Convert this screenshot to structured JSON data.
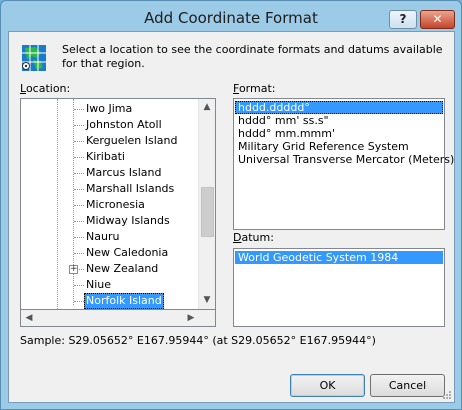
{
  "window": {
    "title": "Add Coordinate Format",
    "help_label": "?",
    "close_label": "✕"
  },
  "intro_text": "Select a location to see the coordinate formats and datums available for that region.",
  "location": {
    "label_accel": "L",
    "label_rest": "ocation:",
    "items": [
      {
        "label": "Iwo Jima"
      },
      {
        "label": "Johnston Atoll"
      },
      {
        "label": "Kerguelen Island"
      },
      {
        "label": "Kiribati"
      },
      {
        "label": "Marcus Island"
      },
      {
        "label": "Marshall Islands"
      },
      {
        "label": "Micronesia"
      },
      {
        "label": "Midway Islands"
      },
      {
        "label": "Nauru"
      },
      {
        "label": "New Caledonia"
      },
      {
        "label": "New Zealand",
        "expander": "+"
      },
      {
        "label": "Niue"
      },
      {
        "label": "Norfolk Island",
        "selected": true
      }
    ]
  },
  "format": {
    "label_accel": "F",
    "label_rest": "ormat:",
    "options": [
      {
        "label": "hddd.ddddd°",
        "selected": true
      },
      {
        "label": "hddd° mm' ss.s\""
      },
      {
        "label": "hddd° mm.mmm'"
      },
      {
        "label": "Military Grid Reference System"
      },
      {
        "label": "Universal Transverse Mercator (Meters)"
      }
    ]
  },
  "datum": {
    "label_accel": "D",
    "label_rest": "atum:",
    "options": [
      {
        "label": "World Geodetic System 1984",
        "selected": true
      }
    ]
  },
  "sample_text": "Sample: S29.05652° E167.95944° (at S29.05652° E167.95944°)",
  "buttons": {
    "ok": "OK",
    "cancel": "Cancel"
  },
  "colors": {
    "selection": "#3399ff",
    "close_button": "#c6452b",
    "frame": "#9ccbe8"
  }
}
